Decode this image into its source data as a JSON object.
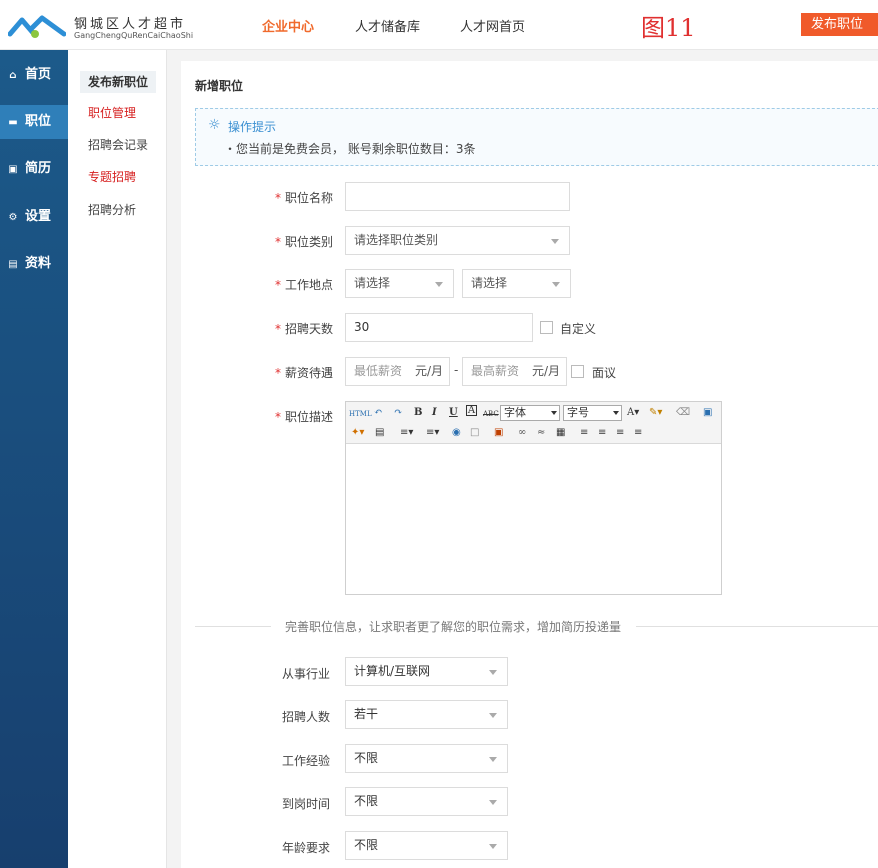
{
  "header": {
    "logo_cn": "钢城区人才超市",
    "logo_en": "GangChengQuRenCaiChaoShi",
    "nav": [
      "企业中心",
      "人才储备库",
      "人才网首页"
    ],
    "figure_label": "图11",
    "publish_button": "发布职位"
  },
  "sidebar": {
    "items": [
      {
        "label": "首页",
        "icon": "home-icon"
      },
      {
        "label": "职位",
        "icon": "card-icon"
      },
      {
        "label": "简历",
        "icon": "id-icon"
      },
      {
        "label": "设置",
        "icon": "gear-icon"
      },
      {
        "label": "资料",
        "icon": "chart-icon"
      }
    ]
  },
  "submenu": {
    "items": [
      "发布新职位",
      "职位管理",
      "招聘会记录",
      "专题招聘",
      "招聘分析"
    ]
  },
  "main": {
    "title": "新增职位",
    "tip_title": "操作提示",
    "tip_text": "・您当前是免费会员， 账号剩余职位数目：3条",
    "fields": {
      "name_label": "职位名称",
      "category_label": "职位类别",
      "category_value": "请选择职位类别",
      "location_label": "工作地点",
      "location_value1": "请选择",
      "location_value2": "请选择",
      "days_label": "招聘天数",
      "days_value": "30",
      "custom_label": "自定义",
      "salary_label": "薪资待遇",
      "salary_min": "最低薪资",
      "salary_max": "最高薪资",
      "salary_unit": "元/月",
      "salary_sep": "-",
      "negotiable_label": "面议",
      "desc_label": "职位描述"
    },
    "editor": {
      "font_select": "字体",
      "size_select": "字号"
    },
    "divider_text": "完善职位信息，让求职者更了解您的职位需求，增加简历投递量",
    "extra": {
      "industry_label": "从事行业",
      "industry_value": "计算机/互联网",
      "headcount_label": "招聘人数",
      "headcount_value": "若干",
      "experience_label": "工作经验",
      "experience_value": "不限",
      "start_label": "到岗时间",
      "start_value": "不限",
      "age_label": "年龄要求",
      "age_value": "不限"
    }
  }
}
